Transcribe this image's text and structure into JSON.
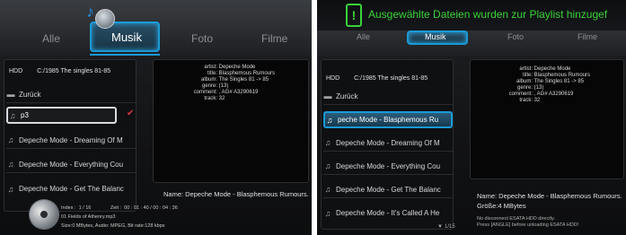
{
  "left": {
    "tabs": [
      {
        "label": "Alle"
      },
      {
        "label": "Musik"
      },
      {
        "label": "Foto"
      },
      {
        "label": "Filme"
      }
    ],
    "path": {
      "drive": "HDD",
      "folder": "C:/1985 The singles 81-85"
    },
    "items": [
      {
        "label": "Zurück",
        "icon": "folder-icon"
      },
      {
        "label": "p3",
        "icon": "music-note-icon"
      },
      {
        "label": "Depeche Mode - Dreaming Of M",
        "icon": "music-note-icon"
      },
      {
        "label": "Depeche Mode - Everything Cou",
        "icon": "music-note-icon"
      },
      {
        "label": "Depeche Mode - Get The Balanc",
        "icon": "music-note-icon"
      }
    ],
    "meta": {
      "artist": "Depeche Mode",
      "title": "Blasphemous Rumours",
      "album": "The Singles 81 -> 85",
      "genre": "(13)",
      "comment": ", AG# A3290619",
      "track": "32"
    },
    "meta_keys": {
      "artist": "artist:",
      "title": "title:",
      "album": "album:",
      "genre": "genre:",
      "comment": "comment:",
      "track": "track:"
    },
    "name_line": "Name: Depeche Mode - Blasphemous Rumours.",
    "info": {
      "index_label": "Index :",
      "index_value": "1 / 16",
      "time_label": "Zeit :",
      "time_value": "00 : 01 : 40 / 00 : 04 : 36",
      "file": "01 Fields of Athenry.mp3",
      "size": "Size:0 MBytes, Audio: MPEG, Bit rate:128 kbps"
    }
  },
  "right": {
    "banner_icon": "!",
    "banner_text": "Ausgewählte Dateien wurden zur Playlist hinzugef",
    "tabs_partial": [
      {
        "label": "Alle"
      },
      {
        "label": "Musik"
      },
      {
        "label": "Foto"
      },
      {
        "label": "Filme"
      }
    ],
    "path": {
      "drive": "HDD",
      "folder": "C:/1985 The singles 81-85"
    },
    "items": [
      {
        "label": "Zurück",
        "icon": "folder-icon"
      },
      {
        "label": "peche Mode - Blasphemous Ru",
        "icon": "music-note-icon"
      },
      {
        "label": "Depeche Mode - Dreaming Of M",
        "icon": "music-note-icon"
      },
      {
        "label": "Depeche Mode - Everything Cou",
        "icon": "music-note-icon"
      },
      {
        "label": "Depeche Mode - Get The Balanc",
        "icon": "music-note-icon"
      },
      {
        "label": "Depeche Mode - It's Called A He",
        "icon": "music-note-icon"
      }
    ],
    "meta": {
      "artist": "Depeche Mode",
      "title": "Blasphemous Rumours",
      "album": "The Singles 81 -> 85",
      "genre": "(13)",
      "comment": ", AG# A3290619",
      "track": "32"
    },
    "meta_keys": {
      "artist": "artist:",
      "title": "title:",
      "album": "album:",
      "genre": "genre:",
      "comment": "comment:",
      "track": "track:"
    },
    "name_line": "Name: Depeche Mode - Blasphemous Rumours.",
    "size_line": "Größe:4 MBytes",
    "warning_1": "No disconnect ESATA HDD directly.",
    "warning_2": "Press [ANGLE] before unloading ESATA HDD!",
    "counter": "1/15"
  },
  "colors": {
    "accent": "#1a9ad6",
    "banner_green": "#3ad23a",
    "mark_red": "#d43a3a"
  }
}
